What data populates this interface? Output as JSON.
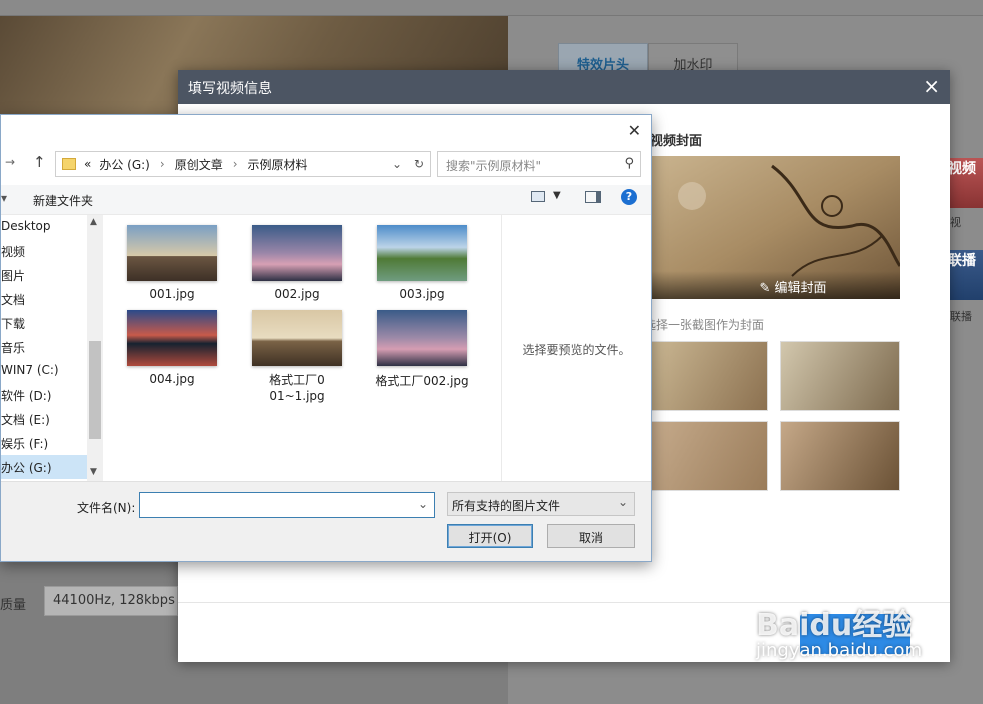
{
  "background_app": {
    "tabs": [
      "特效片头",
      "加水印"
    ],
    "ads": [
      {
        "text": "视频",
        "label": "视"
      },
      {
        "text": "联播",
        "label": "联播"
      }
    ],
    "quality_label": "质量",
    "quality_value": "44100Hz, 128kbps"
  },
  "modal": {
    "title": "填写视频信息",
    "close": "×",
    "cover_title": "视频封面",
    "edit_cover": "编辑封面",
    "cover_hint": "选择一张截图作为封面"
  },
  "file_dialog": {
    "close": "✕",
    "address": {
      "prefix": "«",
      "parts": [
        "办公 (G:)",
        "原创文章",
        "示例原材料"
      ]
    },
    "search_placeholder": "搜索\"示例原材料\"",
    "toolbar": {
      "new_folder": "新建文件夹"
    },
    "sidebar": [
      "Desktop",
      "视频",
      "图片",
      "文档",
      "下载",
      "音乐",
      "WIN7 (C:)",
      "软件 (D:)",
      "文档 (E:)",
      "娱乐 (F:)",
      "办公 (G:)"
    ],
    "files": [
      {
        "name": "001.jpg"
      },
      {
        "name": "002.jpg"
      },
      {
        "name": "003.jpg"
      },
      {
        "name": "004.jpg"
      },
      {
        "name": "格式工厂001~1.jpg"
      },
      {
        "name": "格式工厂002.jpg"
      }
    ],
    "preview_text": "选择要预览的文件。",
    "filename_label": "文件名(N):",
    "filename_value": "",
    "filetype": "所有支持的图片文件",
    "open_button": "打开(O)",
    "cancel_button": "取消"
  },
  "watermark": {
    "logo": "Baidu经验",
    "sub": "jingyan.baidu.com"
  },
  "colors": {
    "modal_header": "#4c5563",
    "accent": "#2d8ae5",
    "selection": "#cce4f7"
  }
}
